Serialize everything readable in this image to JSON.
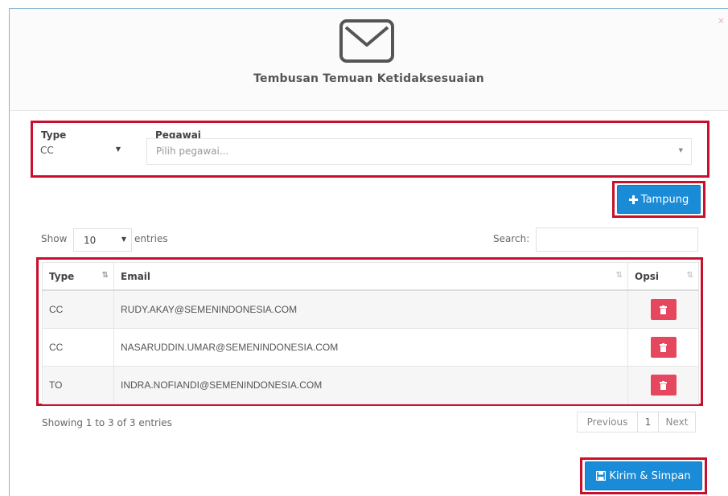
{
  "modal": {
    "title": "Tembusan Temuan Ketidaksesuaian",
    "close_label": "×"
  },
  "form": {
    "type_label": "Type",
    "type_value": "CC",
    "pegawai_label": "Pegawai",
    "pegawai_placeholder": "Pilih pegawai..."
  },
  "buttons": {
    "tampung": "Tampung",
    "kirim": "Kirim & Simpan"
  },
  "table_controls": {
    "show_label": "Show",
    "page_length": "10",
    "entries_label": "entries",
    "search_label": "Search:"
  },
  "table": {
    "columns": [
      "Type",
      "Email",
      "Opsi"
    ],
    "rows": [
      {
        "type": "CC",
        "email": "RUDY.AKAY@SEMENINDONESIA.COM"
      },
      {
        "type": "CC",
        "email": "NASARUDDIN.UMAR@SEMENINDONESIA.COM"
      },
      {
        "type": "TO",
        "email": "INDRA.NOFIANDI@SEMENINDONESIA.COM"
      }
    ]
  },
  "footer": {
    "info": "Showing 1 to 3 of 3 entries",
    "previous": "Previous",
    "page": "1",
    "next": "Next"
  },
  "colors": {
    "primary": "#1a8bd6",
    "danger": "#e5475f",
    "highlight": "#c8102e"
  },
  "icons": [
    "envelope-icon",
    "plus-icon",
    "sort-icon",
    "trash-icon",
    "save-icon",
    "caret-down-icon"
  ]
}
